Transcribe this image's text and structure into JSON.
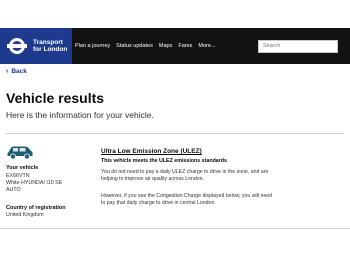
{
  "header": {
    "logo_line1": "Transport",
    "logo_line2": "for London",
    "nav": [
      "Plan a journey",
      "Status updates",
      "Maps",
      "Fares",
      "More..."
    ],
    "search_placeholder": "Search"
  },
  "page": {
    "back_label": "Back",
    "title": "Vehicle results",
    "subtitle": "Here is the information for your vehicle."
  },
  "vehicle": {
    "your_vehicle_label": "Your vehicle",
    "registration": "EX66VTN",
    "description": "White HYUNDAI I10 SE",
    "transmission": "AUTO",
    "country_label": "Country of registration",
    "country": "United Kingdom"
  },
  "ulez": {
    "title": "Ultra Low Emission Zone (ULEZ)",
    "status": "This vehicle meets the ULEZ emissions standards",
    "para1_line1": "You do not need to pay a daily ULEZ charge to drive in the zone, and are",
    "para1_line2": "helping to improve air quality across London.",
    "para2_line1": "However, if you see the Congestion Charge displayed below, you will need",
    "para2_line2": "to pay that daily charge to drive in central London."
  },
  "colors": {
    "brand_blue": "#1d3a8f",
    "header_bg": "#121212",
    "car_icon": "#1f5b73"
  }
}
